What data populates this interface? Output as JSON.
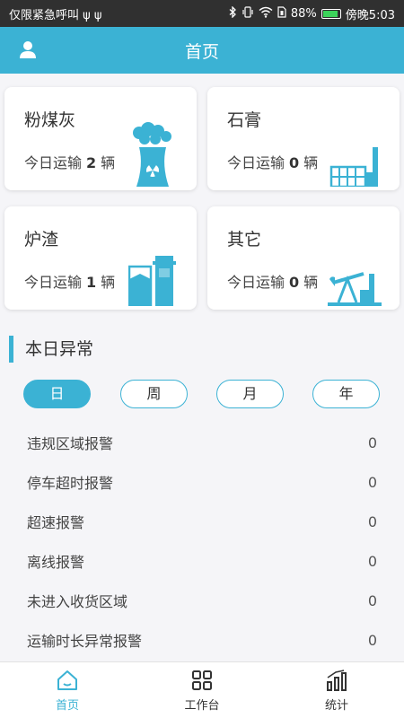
{
  "status_bar": {
    "carrier": "仅限紧急呼叫 ψ ψ",
    "battery": "88%",
    "battery_level": 0.88,
    "time": "傍晚5:03"
  },
  "header": {
    "title": "首页"
  },
  "cards": [
    {
      "name": "粉煤灰",
      "prefix": "今日运输",
      "count": "2",
      "unit": "辆",
      "icon": "power-plant-icon"
    },
    {
      "name": "石膏",
      "prefix": "今日运输",
      "count": "0",
      "unit": "辆",
      "icon": "factory-icon"
    },
    {
      "name": "炉渣",
      "prefix": "今日运输",
      "count": "1",
      "unit": "辆",
      "icon": "tank-icon"
    },
    {
      "name": "其它",
      "prefix": "今日运输",
      "count": "0",
      "unit": "辆",
      "icon": "oil-pump-icon"
    }
  ],
  "section": {
    "title": "本日异常"
  },
  "filters": [
    {
      "label": "日",
      "active": true
    },
    {
      "label": "周",
      "active": false
    },
    {
      "label": "月",
      "active": false
    },
    {
      "label": "年",
      "active": false
    }
  ],
  "alarms": [
    {
      "label": "违规区域报警",
      "count": "0"
    },
    {
      "label": "停车超时报警",
      "count": "0"
    },
    {
      "label": "超速报警",
      "count": "0"
    },
    {
      "label": "离线报警",
      "count": "0"
    },
    {
      "label": "未进入收货区域",
      "count": "0"
    },
    {
      "label": "运输时长异常报警",
      "count": "0"
    }
  ],
  "nav": [
    {
      "label": "首页",
      "icon": "home-icon",
      "active": true
    },
    {
      "label": "工作台",
      "icon": "grid-icon",
      "active": false
    },
    {
      "label": "统计",
      "icon": "bar-chart-icon",
      "active": false
    }
  ],
  "colors": {
    "accent": "#3bb2d4",
    "status_bar": "#303030",
    "battery": "#3cd35a"
  }
}
